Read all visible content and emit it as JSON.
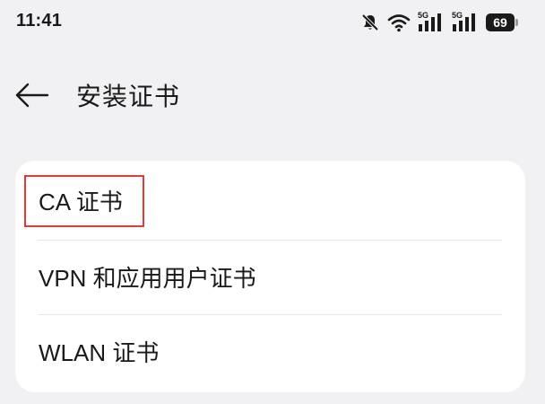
{
  "status_bar": {
    "time": "11:41",
    "network_1": "5G",
    "network_2": "5G",
    "battery": "69",
    "icons": [
      "bell-muted-icon",
      "wifi-icon",
      "cellular-signal-icon",
      "cellular-signal-icon",
      "battery-icon"
    ]
  },
  "header": {
    "back_icon": "arrow-left-icon",
    "title": "安装证书"
  },
  "certificate_list": {
    "items": [
      {
        "label": "CA 证书"
      },
      {
        "label": "VPN 和应用用户证书"
      },
      {
        "label": "WLAN 证书"
      }
    ]
  },
  "colors": {
    "background": "#f1f1f3",
    "card": "#ffffff",
    "text": "#1a1a1a",
    "highlight": "#e53935"
  }
}
